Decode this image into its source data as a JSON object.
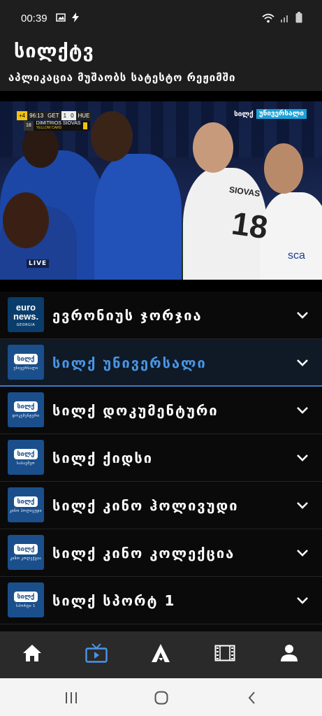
{
  "status_bar": {
    "time": "00:39",
    "left_icons": [
      "image-icon",
      "flash-icon"
    ],
    "right_icons": [
      "wifi-icon",
      "signal-icon",
      "battery-icon"
    ]
  },
  "header": {
    "title": "სილქტვ",
    "subtitle": "აპლიკაცია მუშაობს სატესტო რეჟიმში"
  },
  "video": {
    "scoreboard": {
      "period": "+4",
      "clock": "96:13",
      "home": "GET",
      "home_score": "1",
      "away_score": "0",
      "away": "HUE"
    },
    "card": {
      "number": "18",
      "player": "DIMITRIOS SIOVAS",
      "type": "YELLOW CARD"
    },
    "channel_bug": {
      "brand": "სილქ",
      "channel": "უნივერსალი"
    },
    "live_label": "LIVE",
    "shirt_name": "SIOVAS",
    "shirt_number": "18",
    "shirt_sponsor": "sca"
  },
  "channels": [
    {
      "name": "ევრონიუს ჯორჯია",
      "logo_text": "euro news.",
      "logo_sub": "GEORGIA",
      "logo_bg": "#0a3d6b",
      "active": false
    },
    {
      "name": "სილქ უნივერსალი",
      "logo_text": "სილქ",
      "logo_sub": "უნივერსალი",
      "logo_bg": "#1a4f8c",
      "active": true
    },
    {
      "name": "სილქ დოკუმენტური",
      "logo_text": "სილქ",
      "logo_sub": "დოკუმენტური",
      "logo_bg": "#1a4f8c",
      "active": false
    },
    {
      "name": "სილქ ქიდსი",
      "logo_text": "სილქ",
      "logo_sub": "საბავშვო",
      "logo_bg": "#1a4f8c",
      "active": false
    },
    {
      "name": "სილქ კინო ჰოლივუდი",
      "logo_text": "სილქ",
      "logo_sub": "კინო ჰოლივუდი",
      "logo_bg": "#1a4f8c",
      "active": false
    },
    {
      "name": "სილქ კინო კოლექცია",
      "logo_text": "სილქ",
      "logo_sub": "კინო კოლექცია",
      "logo_bg": "#1a4f8c",
      "active": false
    },
    {
      "name": "სილქ სპორტ 1",
      "logo_text": "სილქ",
      "logo_sub": "სპორტი 1",
      "logo_bg": "#1a4f8c",
      "active": false
    }
  ],
  "bottom_nav": [
    {
      "icon": "home-icon",
      "active": false
    },
    {
      "icon": "tv-icon",
      "active": true
    },
    {
      "icon": "a-logo-icon",
      "active": false
    },
    {
      "icon": "film-icon",
      "active": false
    },
    {
      "icon": "profile-icon",
      "active": false
    }
  ],
  "colors": {
    "accent": "#4a95e6",
    "header_bg": "#1e1e1e",
    "list_bg": "#0a0a0a",
    "active_row_bg": "#0f1a26",
    "logo_blue": "#1a4f8c",
    "bottom_nav_bg": "#2a2a2a"
  }
}
